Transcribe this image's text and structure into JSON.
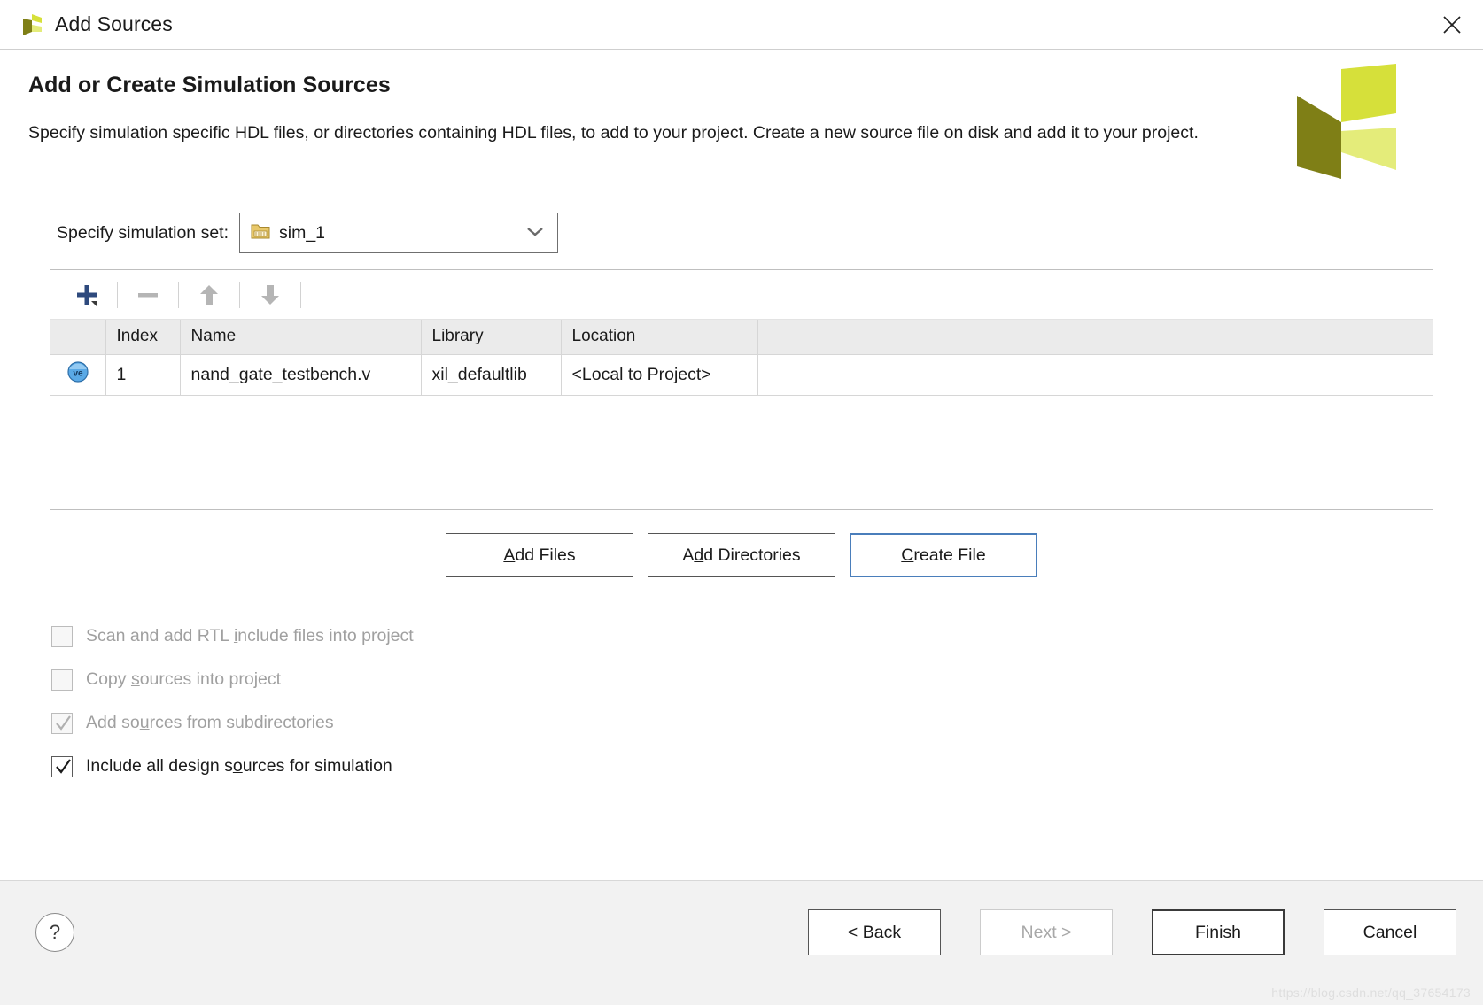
{
  "window": {
    "title": "Add Sources",
    "logo_icon": "vivado-logo-icon",
    "close_icon": "close-icon"
  },
  "header": {
    "title": "Add or Create Simulation Sources",
    "description": "Specify simulation specific HDL files, or directories containing HDL files, to add to your project. Create a new source file on disk and add it to your project.",
    "brand_icon": "xilinx-vivado-brand-icon"
  },
  "simulation_set": {
    "label": "Specify simulation set:",
    "value": "sim_1",
    "folder_icon": "simulation-set-folder-icon",
    "chevron_icon": "chevron-down-icon"
  },
  "toolbar": {
    "add_icon": "plus-icon",
    "remove_icon": "minus-icon",
    "move_up_icon": "arrow-up-icon",
    "move_down_icon": "arrow-down-icon"
  },
  "files_table": {
    "columns": [
      "Index",
      "Name",
      "Library",
      "Location"
    ],
    "rows": [
      {
        "type_icon": "verilog-file-icon",
        "index": "1",
        "name": "nand_gate_testbench.v",
        "library": "xil_defaultlib",
        "location": "<Local to Project>"
      }
    ]
  },
  "actions": {
    "add_files": {
      "pre": "A",
      "mnemonic": "",
      "rest": "dd Files",
      "label": "Add Files"
    },
    "add_directories": {
      "label": "Add Directories"
    },
    "create_file": {
      "label": "Create File"
    }
  },
  "options": [
    {
      "label": "Scan and add RTL include files into project",
      "checked": false,
      "enabled": false
    },
    {
      "label": "Copy sources into project",
      "checked": false,
      "enabled": false
    },
    {
      "label": "Add sources from subdirectories",
      "checked": true,
      "enabled": false
    },
    {
      "label": "Include all design sources for simulation",
      "checked": true,
      "enabled": true
    }
  ],
  "footer": {
    "help_label": "?",
    "back": "< Back",
    "next": "Next >",
    "finish": "Finish",
    "cancel": "Cancel",
    "watermark": "https://blog.csdn.net/qq_37654173"
  },
  "colors": {
    "focus_blue": "#4a7ebb",
    "brand_olive": "#7f7f16",
    "brand_lime": "#d6e03a",
    "footer_bg": "#f2f2f2"
  }
}
